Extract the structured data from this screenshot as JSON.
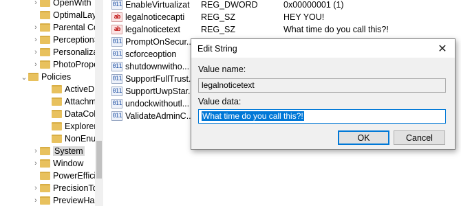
{
  "tree": {
    "items": [
      {
        "label": "OpenWith",
        "expander": "›"
      },
      {
        "label": "OptimalLay",
        "expander": ""
      },
      {
        "label": "Parental Co",
        "expander": "›"
      },
      {
        "label": "PerceptionS",
        "expander": "›"
      },
      {
        "label": "Personaliza",
        "expander": "›"
      },
      {
        "label": "PhotoPrope",
        "expander": "›"
      },
      {
        "label": "Policies",
        "expander": "⌄"
      },
      {
        "label": "ActiveD",
        "expander": ""
      },
      {
        "label": "Attachm",
        "expander": ""
      },
      {
        "label": "DataCol",
        "expander": ""
      },
      {
        "label": "Explorer",
        "expander": ""
      },
      {
        "label": "NonEnu",
        "expander": ""
      },
      {
        "label": "System",
        "expander": "›"
      },
      {
        "label": "Window",
        "expander": "›"
      },
      {
        "label": "PowerEffici",
        "expander": ""
      },
      {
        "label": "PrecisionTo",
        "expander": "›"
      },
      {
        "label": "PreviewHar",
        "expander": "›"
      }
    ]
  },
  "values": {
    "rows": [
      {
        "icon": "dword",
        "icon_text": "011",
        "name": "EnableVirtualizat",
        "type": "REG_DWORD",
        "data": "0x00000001 (1)"
      },
      {
        "icon": "string",
        "icon_text": "ab",
        "name": "legalnoticecapti",
        "type": "REG_SZ",
        "data": "HEY YOU!"
      },
      {
        "icon": "string",
        "icon_text": "ab",
        "name": "legalnoticetext",
        "type": "REG_SZ",
        "data": "What time do you call this?!"
      },
      {
        "icon": "dword",
        "icon_text": "011",
        "name": "PromptOnSecur...",
        "type": "",
        "data": ""
      },
      {
        "icon": "dword",
        "icon_text": "011",
        "name": "scforceoption",
        "type": "",
        "data": ""
      },
      {
        "icon": "dword",
        "icon_text": "011",
        "name": "shutdownwitho...",
        "type": "",
        "data": ""
      },
      {
        "icon": "dword",
        "icon_text": "011",
        "name": "SupportFullTrust...",
        "type": "",
        "data": ""
      },
      {
        "icon": "dword",
        "icon_text": "011",
        "name": "SupportUwpStar...",
        "type": "",
        "data": ""
      },
      {
        "icon": "dword",
        "icon_text": "011",
        "name": "undockwithoutl...",
        "type": "",
        "data": ""
      },
      {
        "icon": "dword",
        "icon_text": "011",
        "name": "ValidateAdminC...",
        "type": "",
        "data": ""
      }
    ]
  },
  "dialog": {
    "title": "Edit String",
    "close_glyph": "✕",
    "value_name_label": "Value name:",
    "value_name": "legalnoticetext",
    "value_data_label": "Value data:",
    "value_data": "What time do you call this?!",
    "ok_label": "OK",
    "cancel_label": "Cancel"
  }
}
